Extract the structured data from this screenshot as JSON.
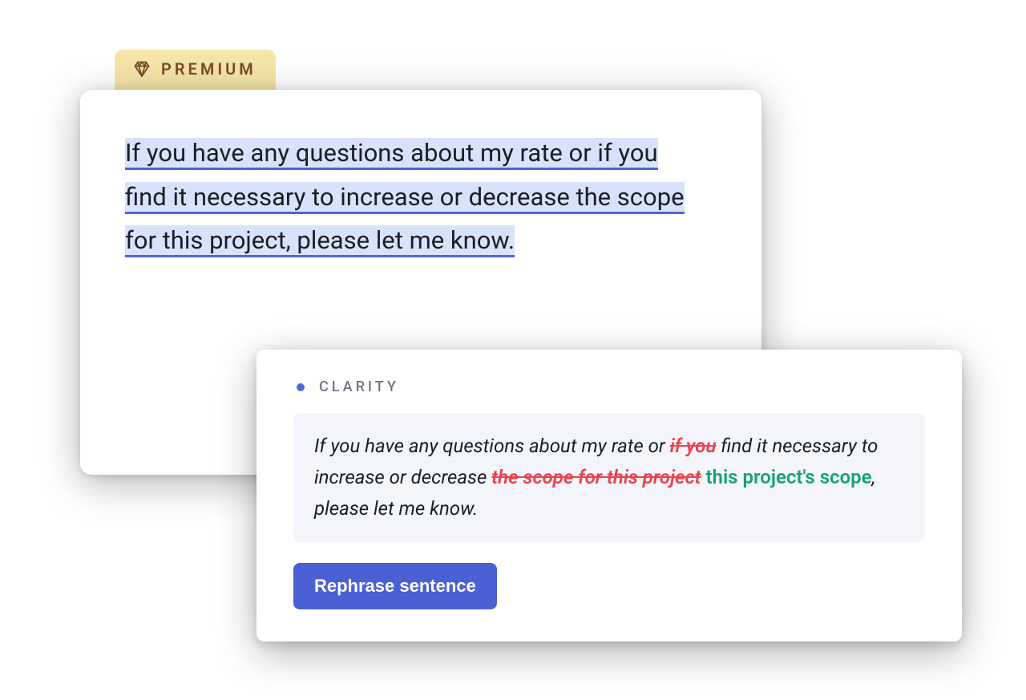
{
  "premium": {
    "label": "PREMIUM"
  },
  "editor": {
    "line1": "If you have any questions about my rate or if you",
    "line2": "find it necessary to increase or decrease the scope",
    "line3": "for this project, please let me know."
  },
  "suggestion": {
    "category": "CLARITY",
    "segments": {
      "p1": "If you have any questions about my rate or ",
      "strike1": "if you",
      "p2": " find it necessary to increase or decrease ",
      "strike2": "the scope for this project",
      "insert1": " this project's scope",
      "p3": ", please let me know."
    },
    "action_label": "Rephrase sentence"
  },
  "colors": {
    "accent": "#4a60d3",
    "strike": "#e9434e",
    "insert": "#15a275",
    "premium_bg": "#f5e5a8",
    "premium_fg": "#7a4a2a"
  }
}
